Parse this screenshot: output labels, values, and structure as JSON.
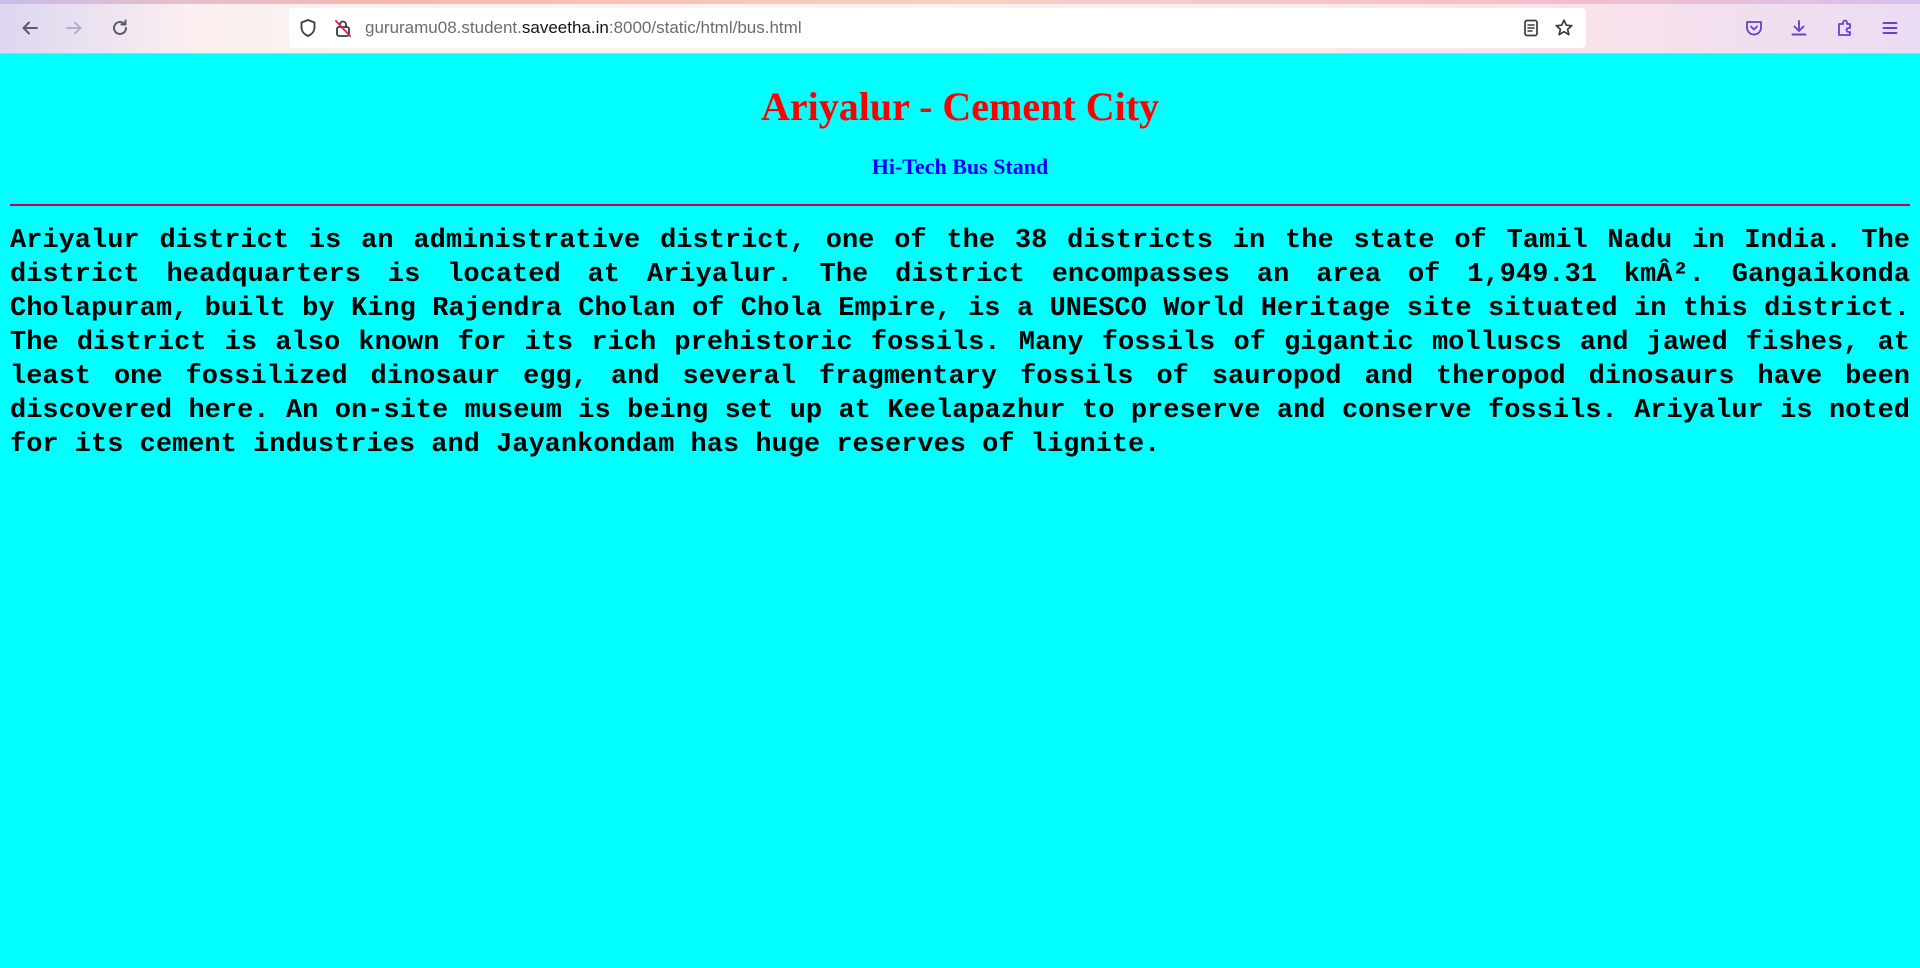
{
  "browser": {
    "url_prefix": "gururamu08.student.",
    "url_host": "saveetha.in",
    "url_suffix": ":8000/static/html/bus.html",
    "icons": {
      "back": "arrow-left-icon",
      "forward": "arrow-right-icon",
      "reload": "reload-icon",
      "shield": "shield-icon",
      "lock_warning": "insecure-lock-icon",
      "reader": "reader-view-icon",
      "bookmark": "star-icon",
      "pocket": "pocket-icon",
      "downloads": "download-icon",
      "extensions": "extensions-icon",
      "menu": "hamburger-menu-icon"
    }
  },
  "page": {
    "background": "#00ffff",
    "title": "Ariyalur - Cement City",
    "title_color": "#ff0000",
    "subtitle": "Hi-Tech Bus Stand",
    "subtitle_color": "#0000ff",
    "body": "Ariyalur district is an administrative district, one of the 38 districts in the state of Tamil Nadu in India. The district headquarters is located at Ariyalur. The district encompasses an area of 1,949.31 kmÂ². Gangaikonda Cholapuram, built by King Rajendra Cholan of Chola Empire, is a UNESCO World Heritage site situated in this district. The district is also known for its rich prehistoric fossils. Many fossils of gigantic molluscs and jawed fishes, at least one fossilized dinosaur egg, and several fragmentary fossils of sauropod and theropod dinosaurs have been discovered here. An on-site museum is being set up at Keelapazhur to preserve and conserve fossils. Ariyalur is noted for its cement industries and Jayankondam has huge reserves of lignite."
  }
}
